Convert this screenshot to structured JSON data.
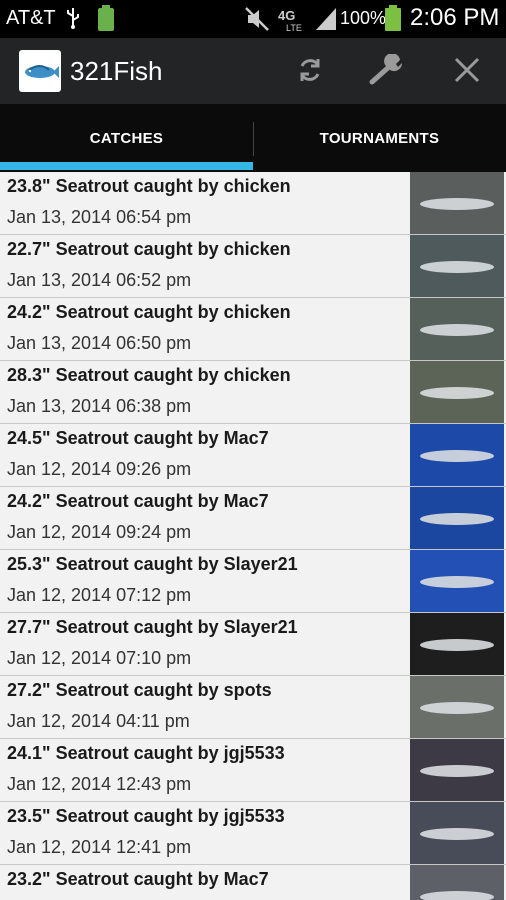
{
  "status_bar": {
    "carrier": "AT&T",
    "battery_percent": "100%",
    "time": "2:06 PM",
    "icons": [
      "usb-icon",
      "battery-small-icon",
      "mute-icon",
      "lte-icon",
      "signal-icon",
      "battery-icon"
    ]
  },
  "action_bar": {
    "app_title": "321Fish",
    "icons": [
      "app-logo-icon",
      "refresh-icon",
      "wrench-icon",
      "close-icon"
    ]
  },
  "tabs": [
    {
      "label": "CATCHES",
      "selected": true
    },
    {
      "label": "TOURNAMENTS",
      "selected": false
    }
  ],
  "colors": {
    "accent": "#33b5e5",
    "action_bar": "#222426",
    "list_bg": "#f2f2f2"
  },
  "catches": [
    {
      "title": "23.8\" Seatrout caught by chicken",
      "date": "Jan 13, 2014 06:54 pm",
      "thumb_color": "#5a5f5e"
    },
    {
      "title": "22.7\" Seatrout caught by chicken",
      "date": "Jan 13, 2014 06:52 pm",
      "thumb_color": "#4e5a5c"
    },
    {
      "title": "24.2\" Seatrout caught by chicken",
      "date": "Jan 13, 2014 06:50 pm",
      "thumb_color": "#55605a"
    },
    {
      "title": "28.3\" Seatrout caught by chicken",
      "date": "Jan 13, 2014 06:38 pm",
      "thumb_color": "#5c6458"
    },
    {
      "title": "24.5\" Seatrout caught by Mac7",
      "date": "Jan 12, 2014 09:26 pm",
      "thumb_color": "#1d4aa8"
    },
    {
      "title": "24.2\" Seatrout caught by Mac7",
      "date": "Jan 12, 2014 09:24 pm",
      "thumb_color": "#1c47a0"
    },
    {
      "title": "25.3\" Seatrout caught by Slayer21",
      "date": "Jan 12, 2014 07:12 pm",
      "thumb_color": "#2250b4"
    },
    {
      "title": "27.7\" Seatrout caught by Slayer21",
      "date": "Jan 12, 2014 07:10 pm",
      "thumb_color": "#1e1e1e"
    },
    {
      "title": "27.2\" Seatrout caught by spots",
      "date": "Jan 12, 2014 04:11 pm",
      "thumb_color": "#6b6f6a"
    },
    {
      "title": "24.1\" Seatrout caught by jgj5533",
      "date": "Jan 12, 2014 12:43 pm",
      "thumb_color": "#3d3a46"
    },
    {
      "title": "23.5\" Seatrout caught by jgj5533",
      "date": "Jan 12, 2014 12:41 pm",
      "thumb_color": "#484c58"
    },
    {
      "title": "23.2\" Seatrout caught by Mac7",
      "date": "",
      "thumb_color": "#5d6066"
    }
  ]
}
